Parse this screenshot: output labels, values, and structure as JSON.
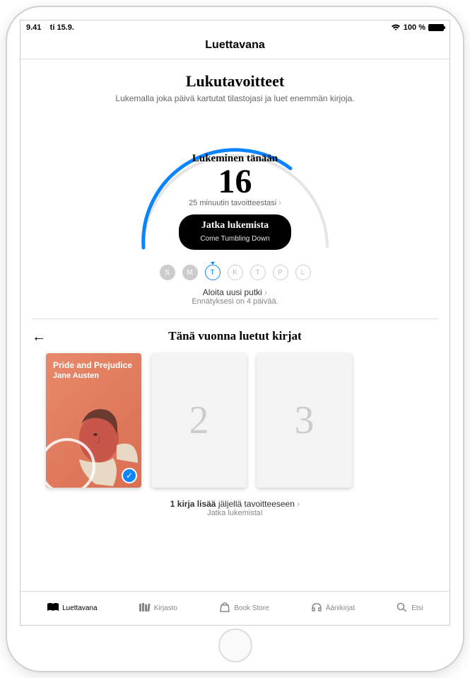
{
  "status": {
    "time": "9.41",
    "date": "ti 15.9.",
    "battery": "100 %"
  },
  "nav": {
    "title": "Luettavana"
  },
  "goals": {
    "title": "Lukutavoitteet",
    "subtitle": "Lukemalla joka päivä kartutat tilastojasi ja luet enemmän kirjoja.",
    "reading_today_label": "Lukeminen tänään",
    "minutes": "16",
    "of_goal": "25 minuutin tavoitteestasi",
    "continue_label": "Jatka lukemista",
    "continue_book": "Come Tumbling Down",
    "progress_ratio": 0.64
  },
  "days": [
    {
      "label": "S",
      "state": "filled"
    },
    {
      "label": "M",
      "state": "filled"
    },
    {
      "label": "T",
      "state": "active"
    },
    {
      "label": "K",
      "state": "empty"
    },
    {
      "label": "T",
      "state": "empty"
    },
    {
      "label": "P",
      "state": "empty"
    },
    {
      "label": "L",
      "state": "empty"
    }
  ],
  "streak": {
    "start_label": "Aloita uusi putki",
    "record": "Ennätyksesi on 4 päivää."
  },
  "books_year": {
    "title": "Tänä vuonna luetut kirjat",
    "book1_title": "Pride and Prejudice",
    "book1_author": "Jane Austen",
    "placeholder2": "2",
    "placeholder3": "3",
    "goal_progress_bold": "1 kirja lisää",
    "goal_progress_rest": " jäljellä tavoitteeseen",
    "goal_sub": "Jatka lukemista!"
  },
  "tabs": [
    {
      "label": "Luettavana",
      "icon": "book-open-icon",
      "active": true
    },
    {
      "label": "Kirjasto",
      "icon": "library-icon",
      "active": false
    },
    {
      "label": "Book Store",
      "icon": "bag-icon",
      "active": false
    },
    {
      "label": "Äänikirjat",
      "icon": "headphones-icon",
      "active": false
    },
    {
      "label": "Etsi",
      "icon": "search-icon",
      "active": false
    }
  ]
}
